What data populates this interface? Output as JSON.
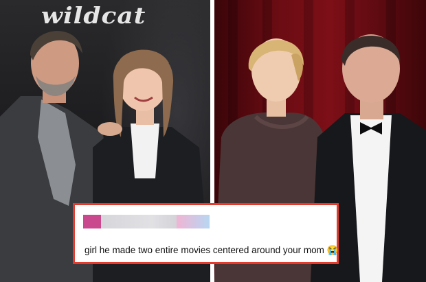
{
  "backdrop_text": "wildcat",
  "tweet": {
    "text": "girl he made two entire movies centered around your mom 😭",
    "border_color": "#e53a2c"
  }
}
